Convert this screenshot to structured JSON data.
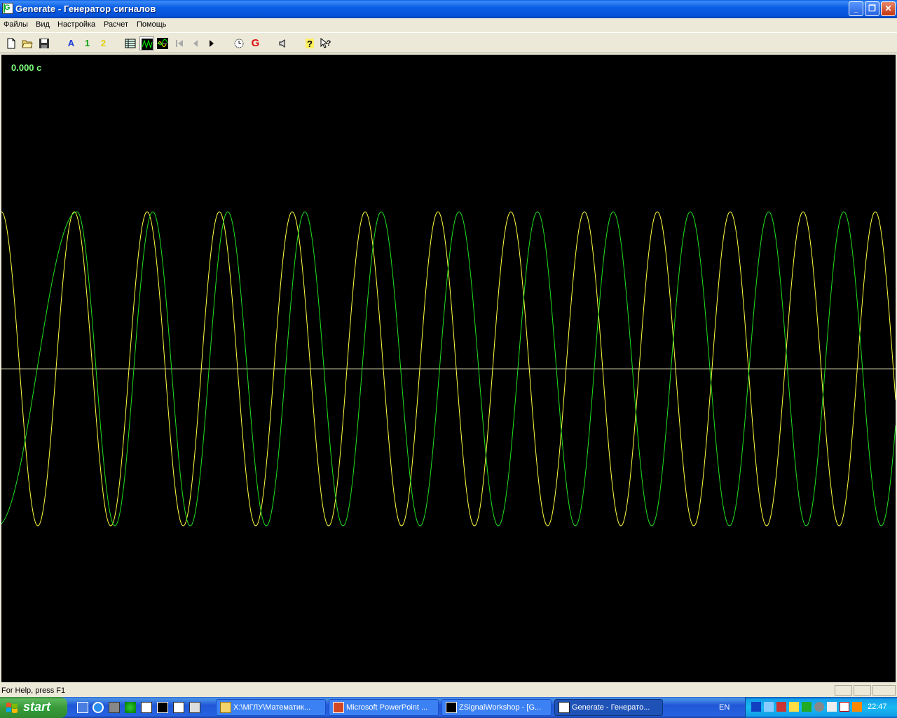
{
  "window": {
    "title": "Generate - Генератор сигналов",
    "controls": {
      "minimize": "_",
      "restore": "❐",
      "close": "✕"
    }
  },
  "menu": [
    "Файлы",
    "Вид",
    "Настройка",
    "Расчет",
    "Помощь"
  ],
  "toolbar": {
    "channel_a": "A",
    "channel_1": "1",
    "channel_2": "2",
    "generate": "G",
    "help": "?"
  },
  "plot": {
    "time_readout": "0.000 с",
    "background": "#000000",
    "axis_color": "#c8c8a0",
    "series": [
      {
        "color": "#ffff40"
      },
      {
        "color": "#20e020"
      }
    ]
  },
  "status": {
    "text": "For Help, press F1"
  },
  "taskbar": {
    "start": "start",
    "tasks": [
      {
        "label": "X:\\МГЛУ\\Математик...",
        "icon": "folder-icon"
      },
      {
        "label": "Microsoft PowerPoint ...",
        "icon": "powerpoint-icon"
      },
      {
        "label": "ZSignalWorkshop - [G...",
        "icon": "zsignal-icon"
      },
      {
        "label": "Generate - Генерато...",
        "icon": "generate-icon",
        "active": true
      }
    ],
    "language": "EN",
    "clock": "22:47"
  }
}
